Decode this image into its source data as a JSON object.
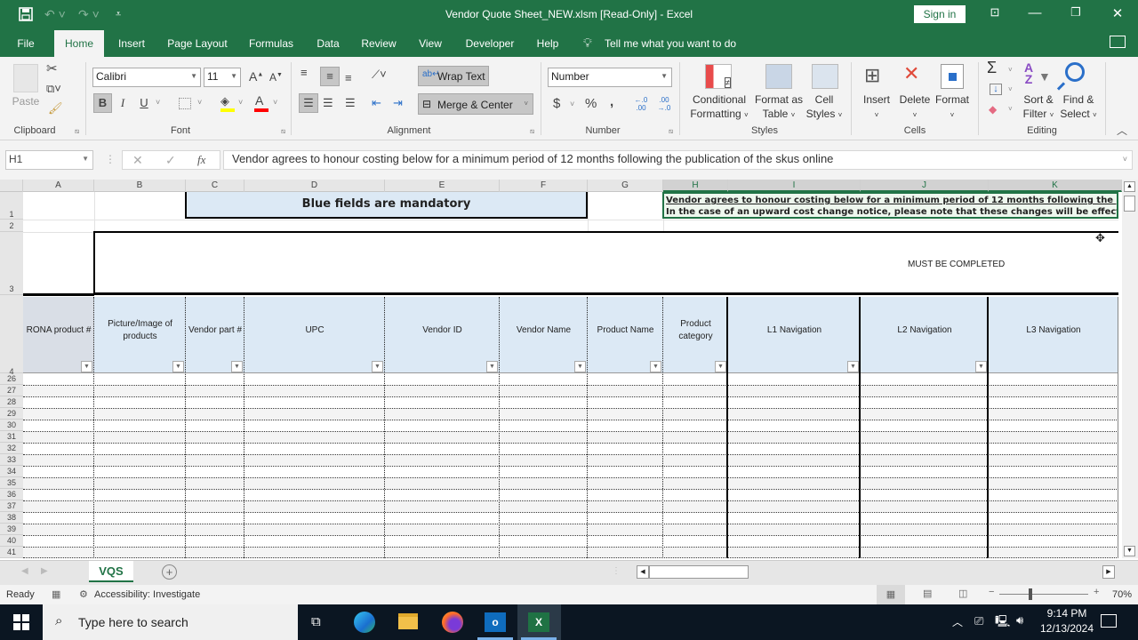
{
  "window": {
    "title": "Vendor Quote Sheet_NEW.xlsm  [Read-Only]  -  Excel",
    "sign_in": "Sign in"
  },
  "quick_access": {
    "save": "save-icon",
    "undo": "undo-icon",
    "redo": "redo-icon",
    "customize": "customize-icon"
  },
  "tabs": [
    "File",
    "Home",
    "Insert",
    "Page Layout",
    "Formulas",
    "Data",
    "Review",
    "View",
    "Developer",
    "Help"
  ],
  "active_tab": "Home",
  "tell_me": "Tell me what you want to do",
  "ribbon": {
    "clipboard": {
      "label": "Clipboard",
      "paste": "Paste"
    },
    "font": {
      "label": "Font",
      "name": "Calibri",
      "size": "11",
      "bold": "B",
      "italic": "I",
      "underline": "U",
      "fill_color": "#ffff00",
      "font_color": "#ff0000"
    },
    "alignment": {
      "label": "Alignment",
      "wrap_text": "Wrap Text",
      "merge_center": "Merge & Center"
    },
    "number": {
      "label": "Number",
      "format": "Number",
      "currency": "$",
      "percent": "%",
      "comma": ",",
      "inc_decimal": "←.0 .00",
      "dec_decimal": ".00 →.0"
    },
    "styles": {
      "label": "Styles",
      "conditional_formatting": [
        "Conditional",
        "Formatting"
      ],
      "format_as_table": [
        "Format as",
        "Table"
      ],
      "cell_styles": [
        "Cell",
        "Styles"
      ]
    },
    "cells": {
      "label": "Cells",
      "insert": "Insert",
      "delete": "Delete",
      "format": "Format"
    },
    "editing": {
      "label": "Editing",
      "sort_filter": [
        "Sort &",
        "Filter"
      ],
      "find_select": [
        "Find &",
        "Select"
      ]
    }
  },
  "formula_bar": {
    "name_box": "H1",
    "fx": "fx",
    "content": "Vendor agrees to honour costing below for a minimum period of 12 months following the publication of the skus online"
  },
  "columns": [
    "A",
    "B",
    "C",
    "D",
    "E",
    "F",
    "G",
    "H",
    "I",
    "J",
    "K"
  ],
  "selected_column": "H",
  "rows": [
    "1",
    "2",
    "3",
    "4",
    "26",
    "27",
    "28",
    "29",
    "30",
    "31",
    "32",
    "33",
    "34",
    "35",
    "36",
    "37",
    "38",
    "39",
    "40",
    "41"
  ],
  "cells": {
    "banner": "Blue fields are mandatory",
    "notice_line1": "Vendor agrees to honour costing below for a minimum period of 12 months following the pub",
    "notice_line2": "In the case of an upward cost change notice, please note that these changes will be effectiv",
    "must_complete": "MUST BE COMPLETED"
  },
  "headers": [
    {
      "col": "A",
      "label": "RONA product #"
    },
    {
      "col": "B",
      "label": "Picture/Image of products"
    },
    {
      "col": "C",
      "label": "Vendor part #"
    },
    {
      "col": "D",
      "label": "UPC"
    },
    {
      "col": "E",
      "label": "Vendor ID"
    },
    {
      "col": "F",
      "label": "Vendor Name"
    },
    {
      "col": "G",
      "label": "Product Name"
    },
    {
      "col": "H",
      "label": "Product category"
    },
    {
      "col": "I",
      "label": "L1 Navigation"
    },
    {
      "col": "J",
      "label": "L2 Navigation"
    },
    {
      "col": "K",
      "label": "L3 Navigation"
    }
  ],
  "sheet_tabs": [
    "VQS"
  ],
  "status": {
    "mode": "Ready",
    "accessibility": "Accessibility: Investigate",
    "zoom": "70%"
  },
  "taskbar": {
    "search_placeholder": "Type here to search",
    "time": "9:14 PM",
    "date": "12/13/2024"
  }
}
